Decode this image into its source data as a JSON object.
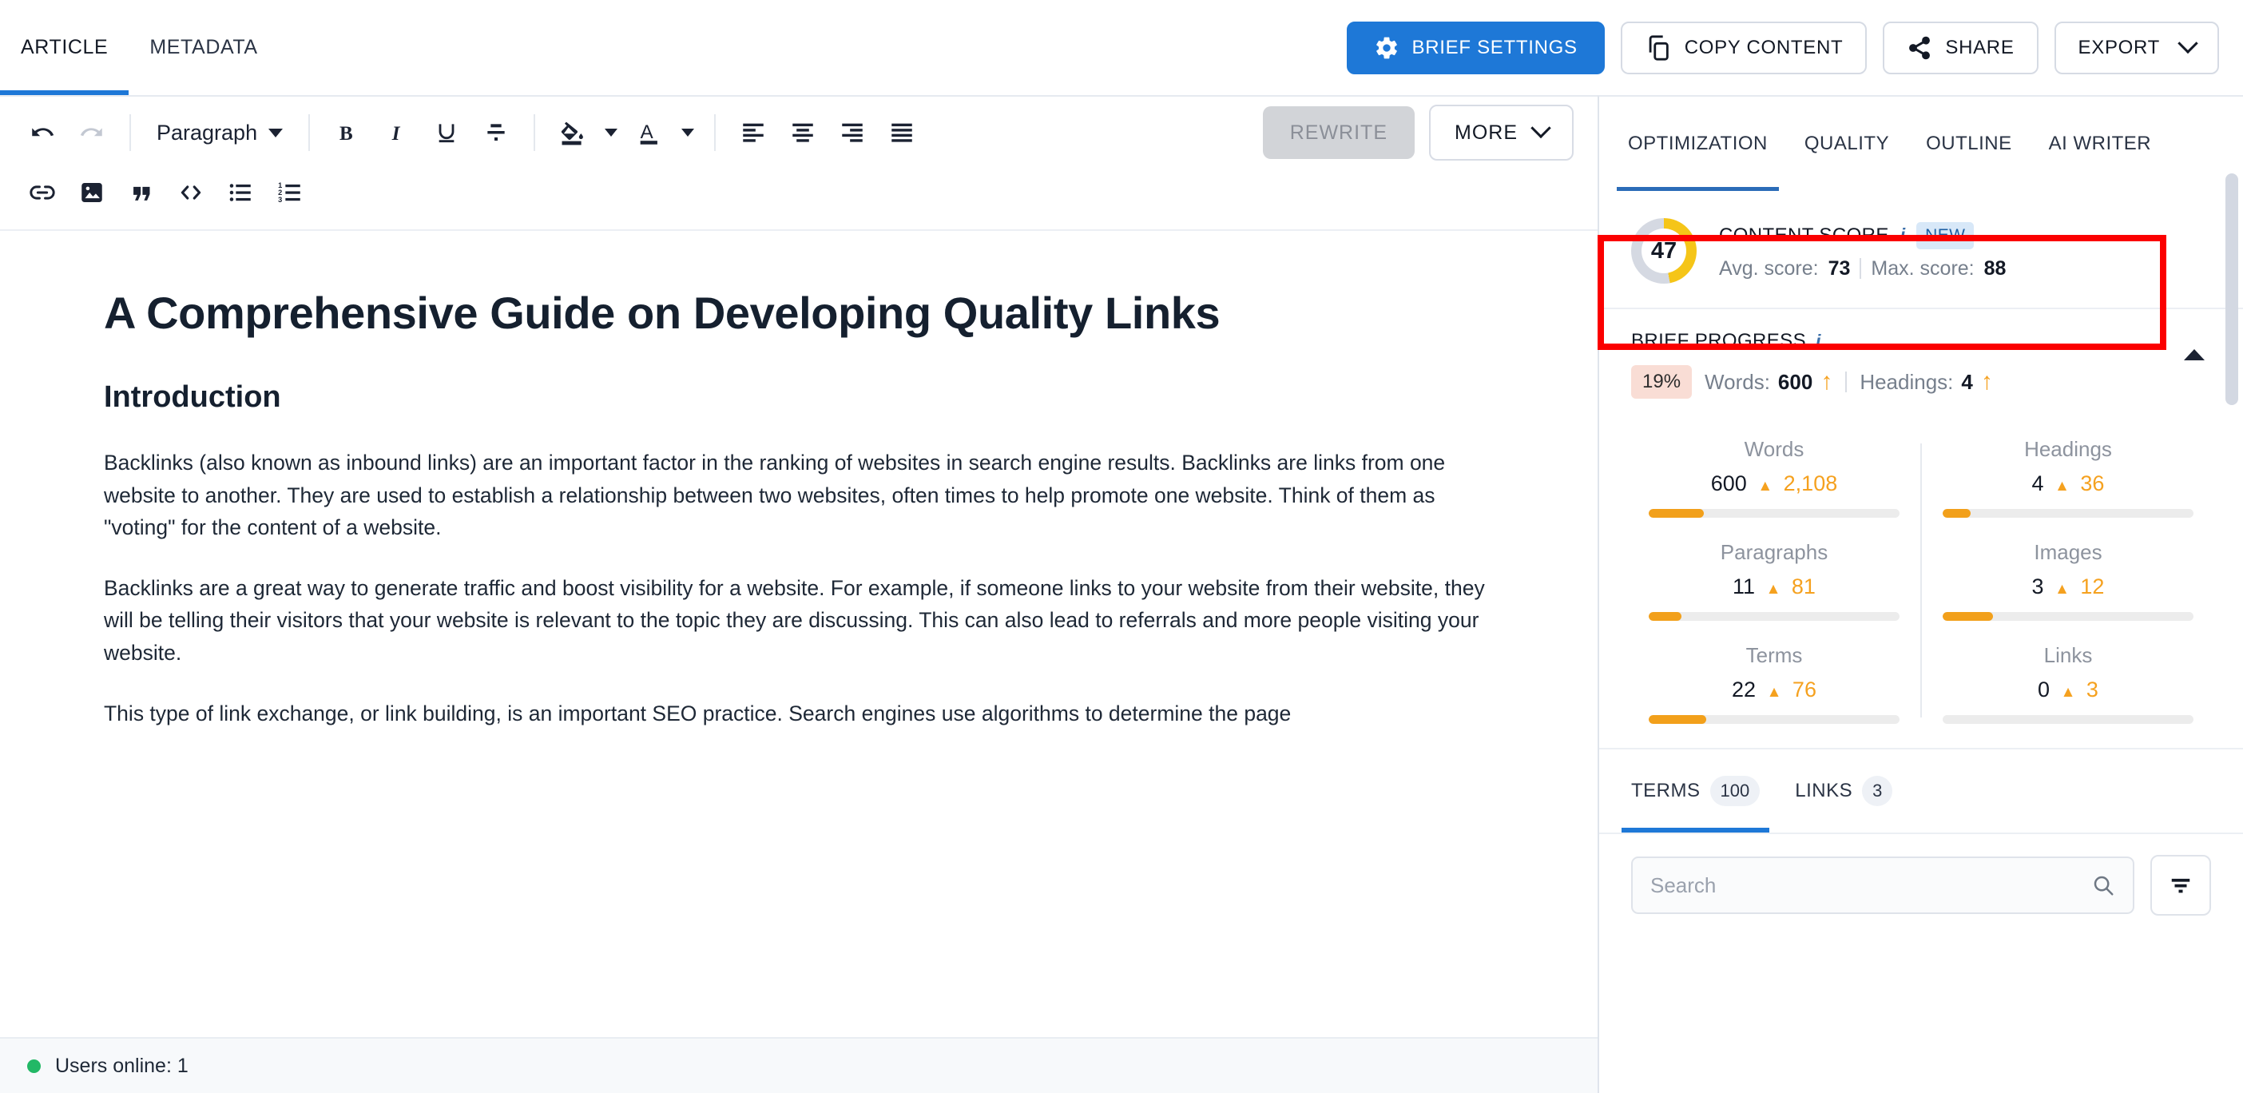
{
  "header": {
    "tabs": [
      {
        "label": "ARTICLE",
        "active": true
      },
      {
        "label": "METADATA",
        "active": false
      }
    ],
    "actions": {
      "brief_settings": "BRIEF SETTINGS",
      "copy_content": "COPY CONTENT",
      "share": "SHARE",
      "export": "EXPORT"
    }
  },
  "toolbar": {
    "block_format": "Paragraph",
    "rewrite": "REWRITE",
    "more": "MORE",
    "icons_row1": [
      "undo-icon",
      "redo-icon",
      "bold-icon",
      "italic-icon",
      "underline-icon",
      "clear-formatting-icon",
      "fill-color-icon",
      "text-color-icon",
      "align-left-icon",
      "align-center-icon",
      "align-right-icon",
      "align-justify-icon"
    ],
    "icons_row2": [
      "link-icon",
      "image-icon",
      "blockquote-icon",
      "code-icon",
      "bullet-list-icon",
      "numbered-list-icon"
    ]
  },
  "document": {
    "title": "A Comprehensive Guide on Developing Quality Links",
    "heading": "Introduction",
    "paragraphs": [
      "Backlinks (also known as inbound links) are an important factor in the ranking of websites in search engine results. Backlinks are links from one website to another. They are used to establish a relationship between two websites, often times to help promote one website. Think of them as \"voting\" for the content of a website.",
      "Backlinks are a great way to generate traffic and boost visibility for a website. For example, if someone links to your website from their website, they will be telling their visitors that your website is relevant to the topic they are discussing. This can also lead to referrals and more people visiting your website.",
      "This type of link exchange, or link building, is an important SEO practice. Search engines use algorithms to determine the page"
    ]
  },
  "status_bar": {
    "users_online": "Users online: 1",
    "status_color": "#22b866"
  },
  "panel": {
    "tabs": [
      {
        "label": "OPTIMIZATION",
        "active": true
      },
      {
        "label": "QUALITY",
        "active": false
      },
      {
        "label": "OUTLINE",
        "active": false
      },
      {
        "label": "AI WRITER",
        "active": false
      }
    ],
    "content_score": {
      "title": "CONTENT SCORE",
      "info_icon": "i",
      "badge": "NEW",
      "score": "47",
      "score_percent": 47,
      "avg_label": "Avg. score:",
      "avg_value": "73",
      "max_label": "Max. score:",
      "max_value": "88",
      "ring_color": "#f5c518",
      "ring_track_color": "#d5d9e2"
    },
    "brief_progress": {
      "title": "BRIEF PROGRESS",
      "info_icon": "i",
      "percent": "19%",
      "words_label": "Words:",
      "words_value": "600",
      "headings_label": "Headings:",
      "headings_value": "4",
      "accent_color": "#f5a11f"
    },
    "metrics": [
      {
        "name": "Words",
        "value": "600",
        "goal": "2,108",
        "fill": 22
      },
      {
        "name": "Headings",
        "value": "4",
        "goal": "36",
        "fill": 11
      },
      {
        "name": "Paragraphs",
        "value": "11",
        "goal": "81",
        "fill": 13
      },
      {
        "name": "Images",
        "value": "3",
        "goal": "12",
        "fill": 20
      },
      {
        "name": "Terms",
        "value": "22",
        "goal": "76",
        "fill": 23
      },
      {
        "name": "Links",
        "value": "0",
        "goal": "3",
        "fill": 0
      }
    ],
    "lower_tabs": [
      {
        "label": "TERMS",
        "count": "100",
        "active": true
      },
      {
        "label": "LINKS",
        "count": "3",
        "active": false
      }
    ],
    "search": {
      "placeholder": "Search",
      "value": ""
    }
  },
  "annotation": {
    "highlight_color": "#fb0000",
    "highlight_target": "content-score-card"
  }
}
